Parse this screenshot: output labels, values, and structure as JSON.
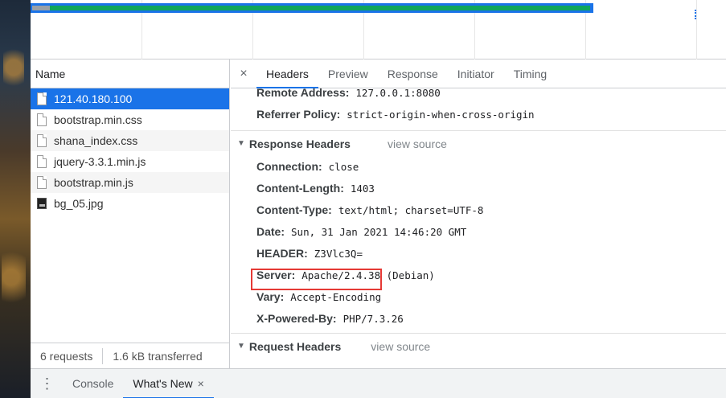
{
  "overview": {
    "progress_fraction": 0.81
  },
  "names": {
    "header": "Name",
    "rows": [
      {
        "label": "121.40.180.100",
        "icon": "document-icon"
      },
      {
        "label": "bootstrap.min.css",
        "icon": "document-icon"
      },
      {
        "label": "shana_index.css",
        "icon": "document-icon"
      },
      {
        "label": "jquery-3.3.1.min.js",
        "icon": "document-icon"
      },
      {
        "label": "bootstrap.min.js",
        "icon": "document-icon"
      },
      {
        "label": "bg_05.jpg",
        "icon": "image-icon"
      }
    ],
    "footer": {
      "requests": "6 requests",
      "transferred": "1.6 kB transferred"
    }
  },
  "detail": {
    "close": "×",
    "tabs": [
      "Headers",
      "Preview",
      "Response",
      "Initiator",
      "Timing"
    ],
    "general": [
      {
        "key": "Remote Address:",
        "value": "127.0.0.1:8080"
      },
      {
        "key": "Referrer Policy:",
        "value": "strict-origin-when-cross-origin"
      }
    ],
    "response_headers": {
      "title": "Response Headers",
      "view_source": "view source",
      "items": [
        {
          "key": "Connection:",
          "value": "close"
        },
        {
          "key": "Content-Length:",
          "value": "1403"
        },
        {
          "key": "Content-Type:",
          "value": "text/html; charset=UTF-8"
        },
        {
          "key": "Date:",
          "value": "Sun, 31 Jan 2021 14:46:20 GMT"
        },
        {
          "key": "HEADER:",
          "value": "Z3Vlc3Q="
        },
        {
          "key": "Server:",
          "value": "Apache/2.4.38 (Debian)"
        },
        {
          "key": "Vary:",
          "value": "Accept-Encoding"
        },
        {
          "key": "X-Powered-By:",
          "value": "PHP/7.3.26"
        }
      ]
    },
    "request_headers": {
      "title": "Request Headers",
      "view_source": "view source"
    }
  },
  "drawer": {
    "menu": "⋮",
    "tabs": [
      {
        "label": "Console"
      },
      {
        "label": "What's New",
        "close": "×"
      }
    ]
  },
  "colors": {
    "accent": "#1a73e8",
    "highlight": "#e53935",
    "download": "#0fa65a"
  }
}
